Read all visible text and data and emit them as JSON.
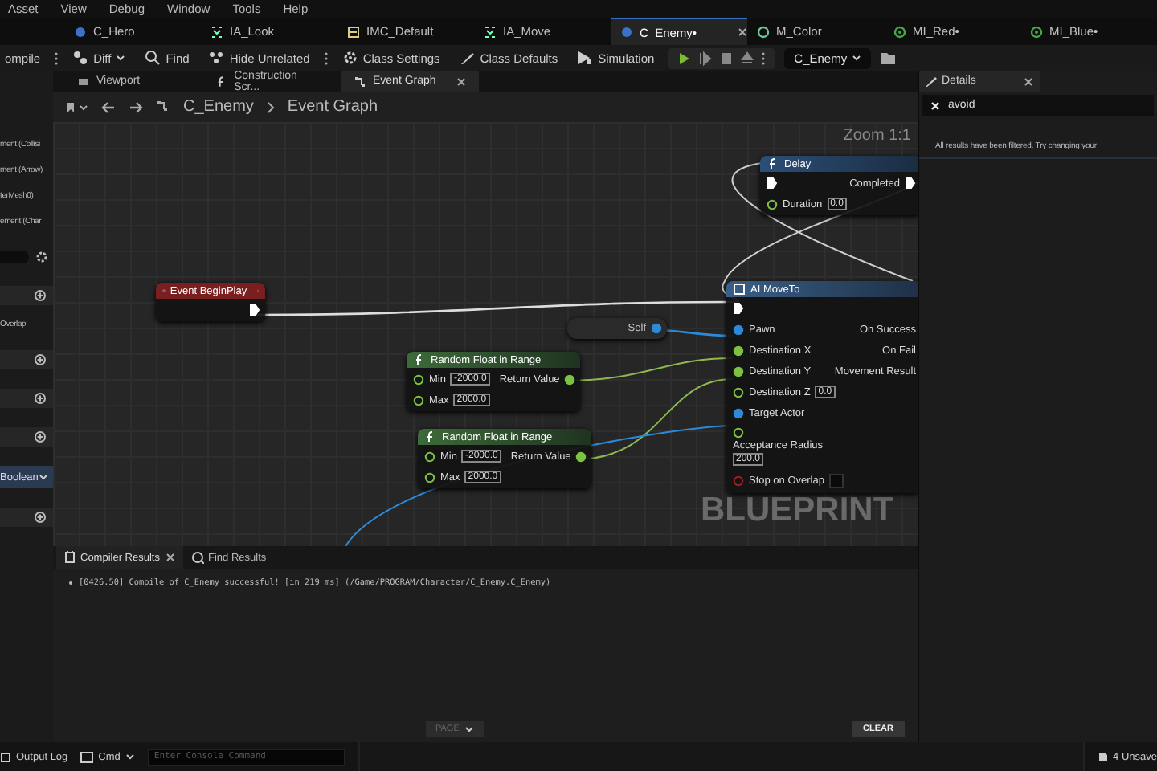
{
  "menu": [
    "Asset",
    "View",
    "Debug",
    "Window",
    "Tools",
    "Help"
  ],
  "file_tabs": [
    {
      "label": "C_Hero",
      "kind": "blueprint",
      "selected": false
    },
    {
      "label": "IA_Look",
      "kind": "action",
      "selected": false
    },
    {
      "label": "IMC_Default",
      "kind": "mapping",
      "selected": false
    },
    {
      "label": "IA_Move",
      "kind": "action",
      "selected": false
    },
    {
      "label": "C_Enemy•",
      "kind": "blueprint",
      "selected": true
    },
    {
      "label": "M_Color",
      "kind": "material",
      "selected": false
    },
    {
      "label": "MI_Red•",
      "kind": "instance",
      "selected": false
    },
    {
      "label": "MI_Blue•",
      "kind": "instance",
      "selected": false
    }
  ],
  "toolbar": [
    {
      "label": "ompile",
      "kind": "compile"
    },
    {
      "label": "Diff",
      "kind": "diff"
    },
    {
      "label": "Find",
      "kind": "find"
    },
    {
      "label": "Hide Unrelated",
      "kind": "hide"
    },
    {
      "label": "Class Settings",
      "kind": "settings"
    },
    {
      "label": "Class Defaults",
      "kind": "defaults"
    },
    {
      "label": "Simulation",
      "kind": "simulation"
    }
  ],
  "debug_object": "C_Enemy",
  "panel_tabs": [
    {
      "label": "Viewport",
      "kind": "viewport",
      "selected": false
    },
    {
      "label": "Construction Scr...",
      "kind": "function",
      "selected": false
    },
    {
      "label": "Event Graph",
      "kind": "graph",
      "selected": true
    }
  ],
  "breadcrumb": [
    "C_Enemy",
    "Event Graph"
  ],
  "left_panel": [
    {
      "kind": "label",
      "text": "ment (Collisi"
    },
    {
      "kind": "label",
      "text": "ment (Arrow)"
    },
    {
      "kind": "label",
      "text": "terMesh0)"
    },
    {
      "kind": "label",
      "text": "ement (Char"
    },
    {
      "kind": "search"
    },
    {
      "kind": "add"
    },
    {
      "kind": "label",
      "text": "Overlap"
    },
    {
      "kind": "add"
    },
    {
      "kind": "add"
    },
    {
      "kind": "add"
    },
    {
      "kind": "select",
      "text": "Boolean"
    },
    {
      "kind": "add"
    }
  ],
  "graph": {
    "zoom": "Zoom 1:1",
    "watermark": "BLUEPRINT",
    "nodes": [
      {
        "kind": "event",
        "title": "Event BeginPlay",
        "outputs": [
          {
            "kind": "exec",
            "connected": true
          }
        ]
      },
      {
        "kind": "function",
        "title": "Delay",
        "inputs": [
          {
            "kind": "exec",
            "connected": true
          },
          {
            "label": "Duration",
            "kind": "float",
            "connected": false,
            "value": "0.0"
          }
        ],
        "outputs": [
          {
            "label": "Completed",
            "kind": "exec",
            "connected": true
          }
        ]
      },
      {
        "kind": "latent",
        "title": "AI MoveTo",
        "inputs": [
          {
            "kind": "exec",
            "connected": true
          },
          {
            "label": "Pawn",
            "kind": "object",
            "connected": true
          },
          {
            "label": "Destination X",
            "kind": "float",
            "connected": true
          },
          {
            "label": "Destination Y",
            "kind": "float",
            "connected": true
          },
          {
            "label": "Destination Z",
            "kind": "float",
            "connected": false,
            "value": "0.0"
          },
          {
            "label": "Target Actor",
            "kind": "object",
            "connected": true
          },
          {
            "label": "Acceptance Radius",
            "kind": "float",
            "connected": false,
            "value": "200.0"
          },
          {
            "label": "Stop on Overlap",
            "kind": "bool",
            "connected": false,
            "checked": false
          }
        ],
        "outputs": [
          {
            "kind": "none"
          },
          {
            "label": "On Success",
            "kind": "none"
          },
          {
            "label": "On Fail",
            "kind": "none"
          },
          {
            "label": "Movement Result",
            "kind": "none"
          }
        ]
      },
      {
        "kind": "variable",
        "title": "Self",
        "outputs": [
          {
            "kind": "object",
            "connected": true
          }
        ]
      },
      {
        "kind": "pure",
        "title": "Random Float in Range",
        "inputs": [
          {
            "label": "Min",
            "kind": "float",
            "connected": false,
            "value": "-2000.0"
          },
          {
            "label": "Max",
            "kind": "float",
            "connected": false,
            "value": "2000.0"
          }
        ],
        "outputs": [
          {
            "label": "Return Value",
            "kind": "float",
            "connected": true
          }
        ]
      },
      {
        "kind": "pure",
        "title": "Random Float in Range",
        "inputs": [
          {
            "label": "Min",
            "kind": "float",
            "connected": false,
            "value": "-2000.0"
          },
          {
            "label": "Max",
            "kind": "float",
            "connected": false,
            "value": "2000.0"
          }
        ],
        "outputs": [
          {
            "label": "Return Value",
            "kind": "float",
            "connected": true
          }
        ]
      }
    ]
  },
  "bottom_tabs": [
    {
      "label": "Compiler Results",
      "selected": true
    },
    {
      "label": "Find Results",
      "selected": false
    }
  ],
  "log": [
    "[0426.50] Compile of C_Enemy successful! [in 219 ms] (/Game/PROGRAM/Character/C_Enemy.C_Enemy)"
  ],
  "page_button": "PAGE",
  "clear_button": "CLEAR",
  "details": {
    "title": "Details",
    "search": "avoid",
    "message": "All results have been filtered. Try changing your"
  },
  "status_bar": {
    "output_log": "Output Log",
    "cmd": "Cmd",
    "console_placeholder": "Enter Console Command",
    "unsaved": "4 Unsave"
  }
}
